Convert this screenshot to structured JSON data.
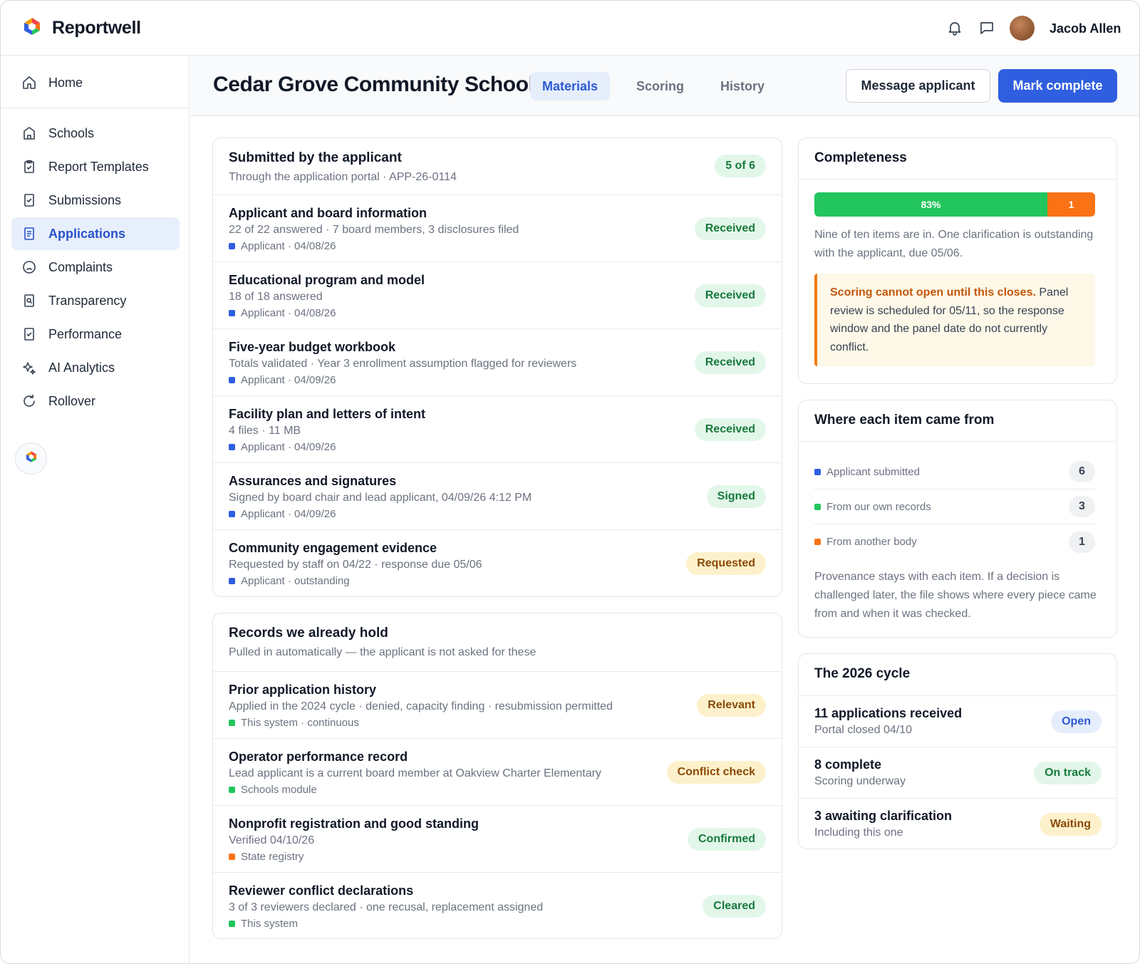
{
  "app": {
    "name": "Reportwell"
  },
  "user": {
    "name": "Jacob Allen"
  },
  "sidebar": {
    "items": [
      {
        "label": "Home",
        "icon": "home-icon"
      },
      {
        "label": "Schools",
        "icon": "building-icon"
      },
      {
        "label": "Report Templates",
        "icon": "clipboard-icon"
      },
      {
        "label": "Submissions",
        "icon": "checkbox-doc-icon"
      },
      {
        "label": "Applications",
        "icon": "document-icon",
        "active": true
      },
      {
        "label": "Complaints",
        "icon": "frown-icon"
      },
      {
        "label": "Transparency",
        "icon": "search-doc-icon"
      },
      {
        "label": "Performance",
        "icon": "checkbox-doc-icon"
      },
      {
        "label": "AI Analytics",
        "icon": "sparkle-icon"
      },
      {
        "label": "Rollover",
        "icon": "refresh-icon"
      }
    ]
  },
  "header": {
    "title": "Cedar Grove Community School",
    "tabs": [
      "Materials",
      "Scoring",
      "History"
    ],
    "active_tab": "Materials",
    "message_label": "Message applicant",
    "complete_label": "Mark complete"
  },
  "submitted": {
    "title": "Submitted by the applicant",
    "subtitle": "Through the application portal · APP-26-0114",
    "badge": "5 of 6",
    "items": [
      {
        "title": "Applicant and board information",
        "detail": "22 of 22 answered · 7 board members, 3 disclosures filed",
        "source": "Applicant · 04/08/26",
        "status": "Received"
      },
      {
        "title": "Educational program and model",
        "detail": "18 of 18 answered",
        "source": "Applicant · 04/08/26",
        "status": "Received"
      },
      {
        "title": "Five-year budget workbook",
        "detail": "Totals validated · Year 3 enrollment assumption flagged for reviewers",
        "source": "Applicant · 04/09/26",
        "status": "Received"
      },
      {
        "title": "Facility plan and letters of intent",
        "detail": "4 files · 11 MB",
        "source": "Applicant · 04/09/26",
        "status": "Received"
      },
      {
        "title": "Assurances and signatures",
        "detail": "Signed by board chair and lead applicant, 04/09/26 4:12 PM",
        "source": "Applicant · 04/09/26",
        "status": "Signed"
      },
      {
        "title": "Community engagement evidence",
        "detail": "Requested by staff on 04/22 · response due 05/06",
        "source": "Applicant · outstanding",
        "status": "Requested"
      }
    ]
  },
  "records": {
    "title": "Records we already hold",
    "subtitle": "Pulled in automatically — the applicant is not asked for these",
    "items": [
      {
        "title": "Prior application history",
        "detail": "Applied in the 2024 cycle · denied, capacity finding · resubmission permitted",
        "source": "This system · continuous",
        "status": "Relevant"
      },
      {
        "title": "Operator performance record",
        "detail": "Lead applicant is a current board member at Oakview Charter Elementary",
        "source": "Schools module",
        "status": "Conflict check"
      },
      {
        "title": "Nonprofit registration and good standing",
        "detail": "Verified 04/10/26",
        "source": "State registry",
        "status": "Confirmed"
      },
      {
        "title": "Reviewer conflict declarations",
        "detail": "3 of 3 reviewers declared · one recusal, replacement assigned",
        "source": "This system",
        "status": "Cleared"
      }
    ]
  },
  "completeness": {
    "title": "Completeness",
    "percent_label": "83%",
    "percent": 83,
    "outstanding_label": "1",
    "summary": "Nine of ten items are in. One clarification is outstanding with the applicant, due 05/06.",
    "warning_strong": "Scoring cannot open until this closes.",
    "warning_rest": " Panel review is scheduled for 05/11, so the response window and the panel date do not currently conflict."
  },
  "provenance": {
    "title": "Where each item came from",
    "rows": [
      {
        "label": "Applicant submitted",
        "count": "6",
        "color": "#2f5fe0"
      },
      {
        "label": "From our own records",
        "count": "3",
        "color": "#22c55e"
      },
      {
        "label": "From another body",
        "count": "1",
        "color": "#f97316"
      }
    ],
    "note": "Provenance stays with each item. If a decision is challenged later, the file shows where every piece came from and when it was checked."
  },
  "cycle": {
    "title": "The 2026 cycle",
    "rows": [
      {
        "title": "11 applications received",
        "sub": "Portal closed 04/10",
        "status": "Open"
      },
      {
        "title": "8 complete",
        "sub": "Scoring underway",
        "status": "On track"
      },
      {
        "title": "3 awaiting clarification",
        "sub": "Including this one",
        "status": "Waiting"
      }
    ]
  },
  "colors": {
    "accent": "#2f5fe0",
    "success": "#22c55e",
    "warning": "#f97316"
  }
}
